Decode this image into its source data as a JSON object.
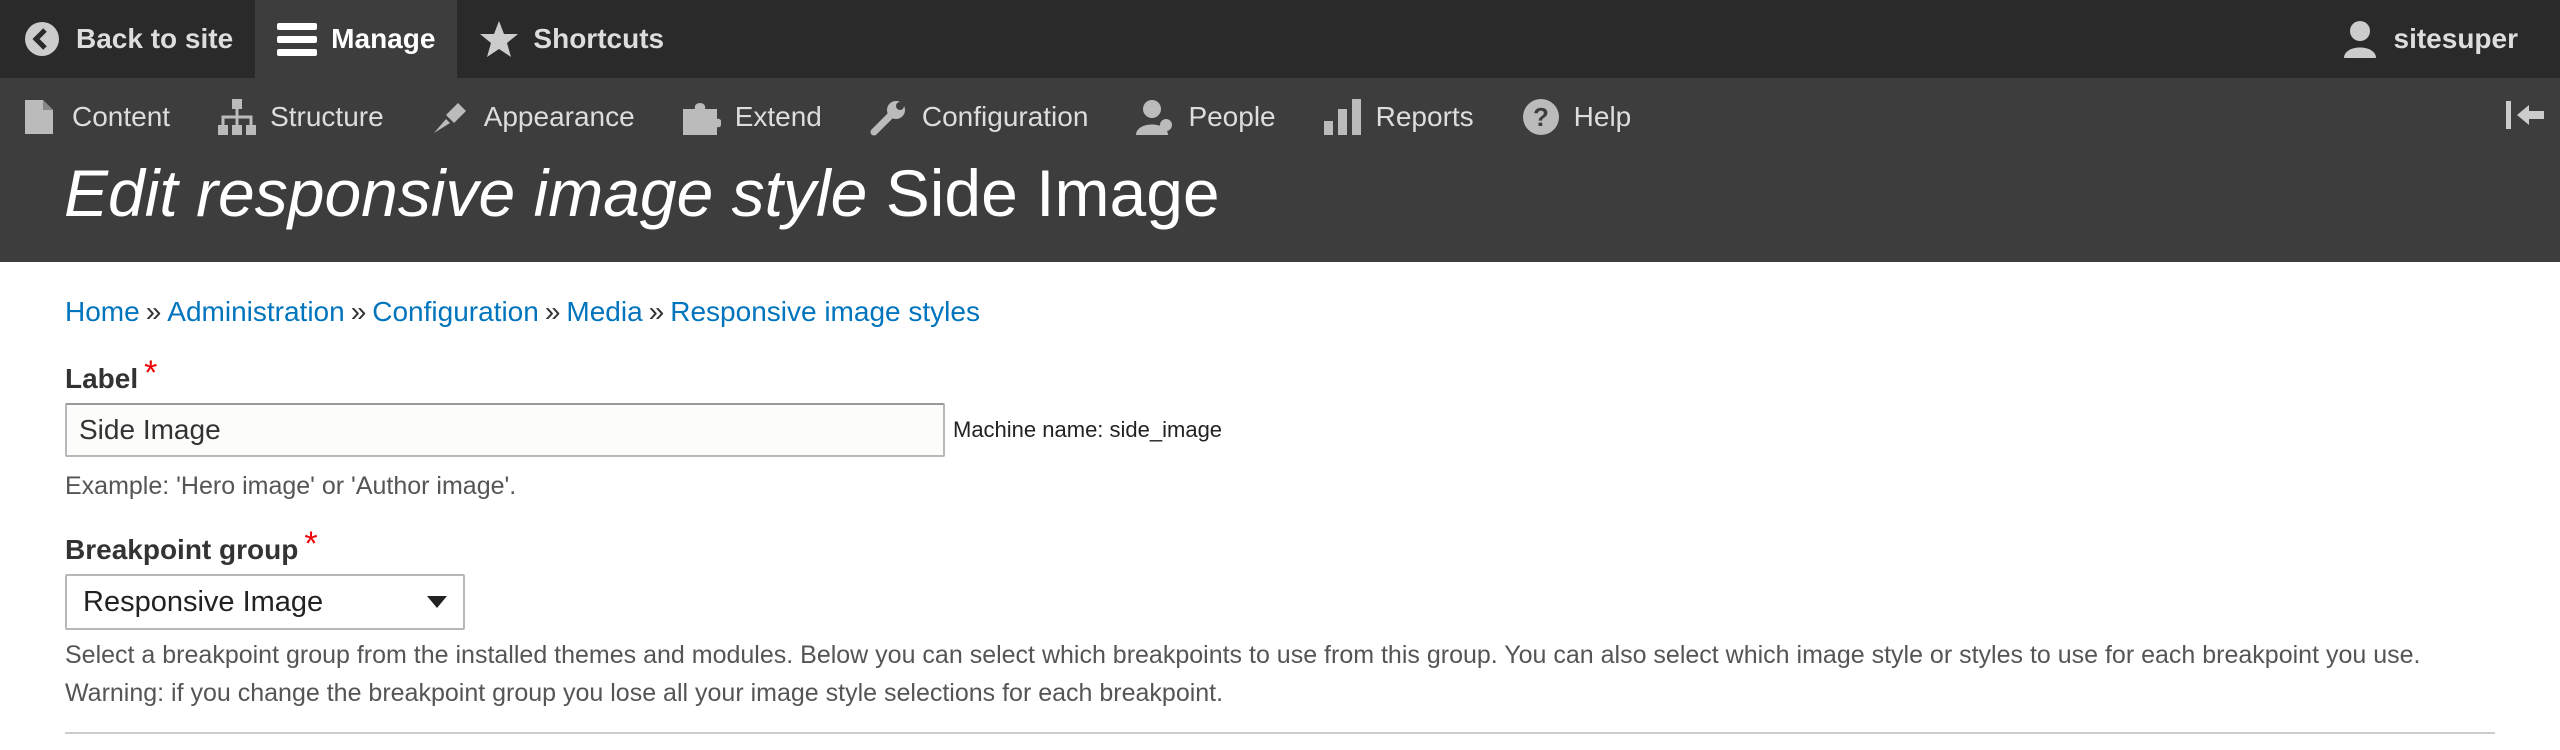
{
  "toolbar": {
    "back_label": "Back to site",
    "manage_label": "Manage",
    "shortcuts_label": "Shortcuts",
    "user_label": "sitesuper"
  },
  "tray": {
    "items": [
      {
        "label": "Content",
        "icon": "document-icon"
      },
      {
        "label": "Structure",
        "icon": "structure-icon"
      },
      {
        "label": "Appearance",
        "icon": "paintbrush-icon"
      },
      {
        "label": "Extend",
        "icon": "puzzle-icon"
      },
      {
        "label": "Configuration",
        "icon": "wrench-icon"
      },
      {
        "label": "People",
        "icon": "people-icon"
      },
      {
        "label": "Reports",
        "icon": "bar-chart-icon"
      },
      {
        "label": "Help",
        "icon": "help-icon"
      }
    ]
  },
  "page": {
    "title_em": "Edit responsive image style",
    "title_rest": "Side Image"
  },
  "breadcrumb": {
    "items": [
      "Home",
      "Administration",
      "Configuration",
      "Media",
      "Responsive image styles"
    ],
    "separator": "»"
  },
  "form": {
    "label_field": {
      "label": "Label",
      "required_mark": "*",
      "value": "Side Image",
      "machine_name": "Machine name: side_image",
      "description": "Example: 'Hero image' or 'Author image'."
    },
    "breakpoint_field": {
      "label": "Breakpoint group",
      "required_mark": "*",
      "selected": "Responsive Image",
      "description": "Select a breakpoint group from the installed themes and modules. Below you can select which breakpoints to use from this group. You can also select which image style or styles to use for each breakpoint you use. Warning: if you change the breakpoint group you lose all your image style selections for each breakpoint."
    }
  },
  "colors": {
    "toolbar_bg": "#2a2a2a",
    "tray_bg": "#3d3d3d",
    "link": "#0074bd",
    "required": "#e00000"
  }
}
